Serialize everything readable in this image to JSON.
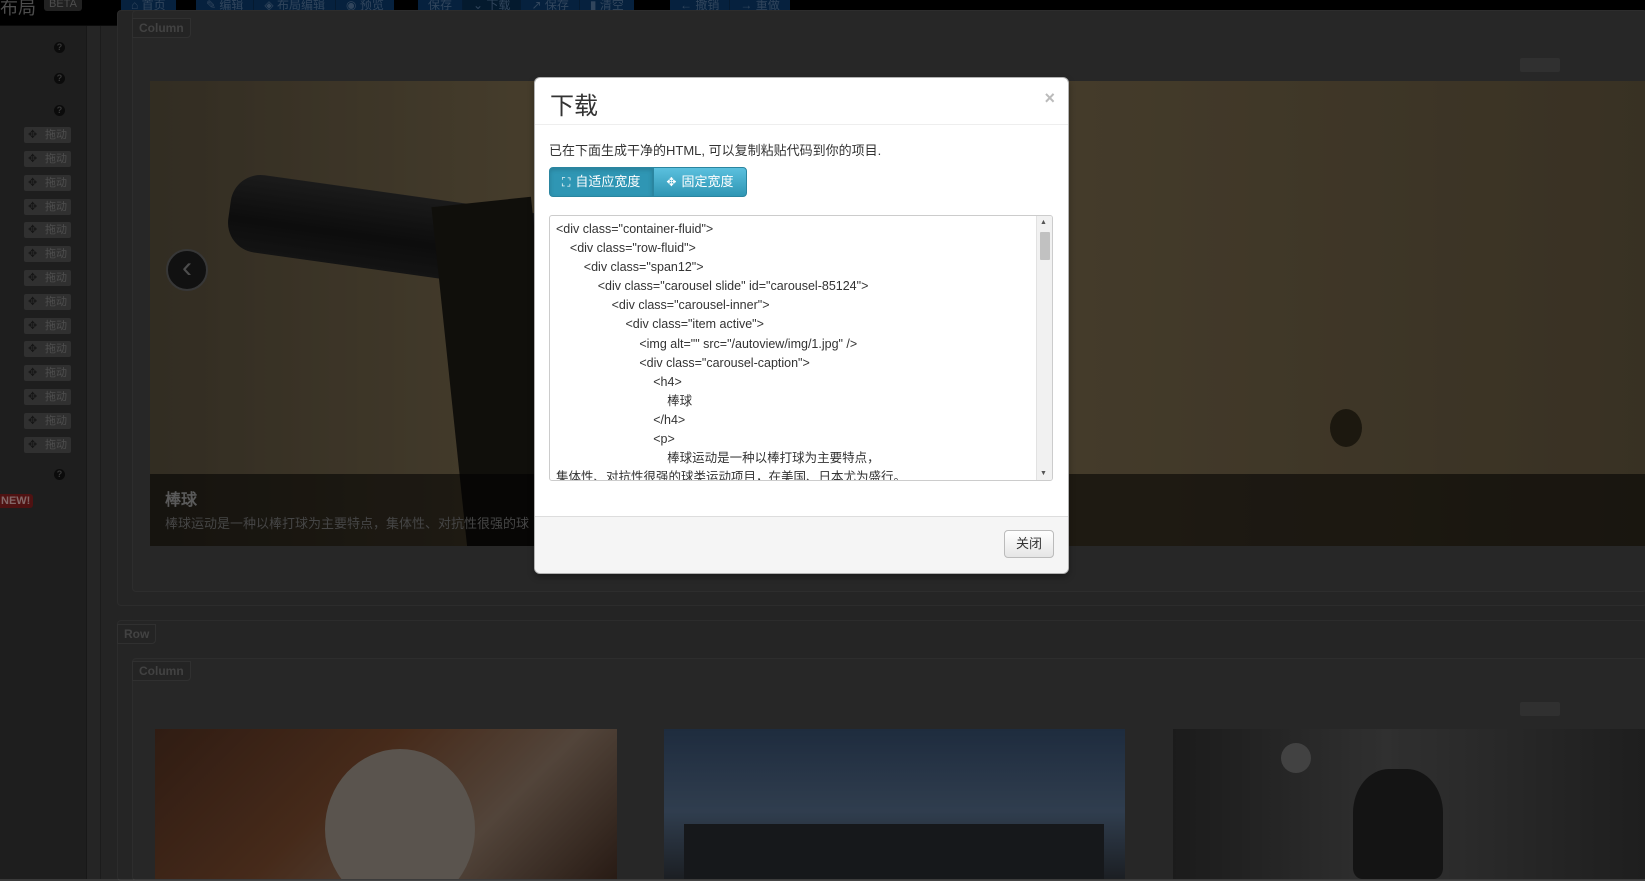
{
  "navbar": {
    "brand": "布局",
    "beta_badge": "BETA",
    "buttons_group1": [
      {
        "icon": "home-icon",
        "label": "首页"
      }
    ],
    "buttons_group2": [
      {
        "icon": "edit-icon",
        "label": "编辑"
      },
      {
        "icon": "layout-edit-icon",
        "label": "布局编辑"
      },
      {
        "icon": "eye-icon",
        "label": "预览"
      }
    ],
    "buttons_group3": [
      {
        "icon": "",
        "label": "保存"
      },
      {
        "icon": "chevron-down-icon",
        "label": "下载"
      },
      {
        "icon": "share-icon",
        "label": "保存"
      },
      {
        "icon": "trash-icon",
        "label": "清空"
      }
    ],
    "buttons_group4": [
      {
        "icon": "arrow-left-icon",
        "label": "撤销"
      },
      {
        "icon": "arrow-right-icon",
        "label": "重做"
      }
    ]
  },
  "sidebar": {
    "help_marker": "?",
    "drag_label": "拖动",
    "drag_items_count_label": "",
    "new_badge": "NEW!"
  },
  "canvas": {
    "column_label": "Column",
    "row_label": "Row",
    "carousel": {
      "prev_arrow": "‹",
      "caption_title": "棒球",
      "caption_text": "棒球运动是一种以棒打球为主要特点，集体性、对抗性很强的球"
    }
  },
  "modal": {
    "title": "下载",
    "close_symbol": "×",
    "intro": "已在下面生成干净的HTML, 可以复制粘贴代码到你的项目.",
    "btn_fluid": "自适应宽度",
    "btn_fixed": "固定宽度",
    "code": "<div class=\"container-fluid\">\n\t<div class=\"row-fluid\">\n\t\t<div class=\"span12\">\n\t\t\t<div class=\"carousel slide\" id=\"carousel-85124\">\n\t\t\t\t<div class=\"carousel-inner\">\n\t\t\t\t\t<div class=\"item active\">\n\t\t\t\t\t\t<img alt=\"\" src=\"/autoview/img/1.jpg\" />\n\t\t\t\t\t\t<div class=\"carousel-caption\">\n\t\t\t\t\t\t\t<h4>\n\t\t\t\t\t\t\t\t棒球\n\t\t\t\t\t\t\t</h4>\n\t\t\t\t\t\t\t<p>\n\t\t\t\t\t\t\t\t棒球运动是一种以棒打球为主要特点，\n集体性、对抗性很强的球类运动项目，在美国、日本尤为盛行。",
    "footer_close": "关闭"
  },
  "colors": {
    "accent_info": "#2f96b4",
    "navbar_bg": "#000000",
    "modal_bg": "#ffffff"
  }
}
